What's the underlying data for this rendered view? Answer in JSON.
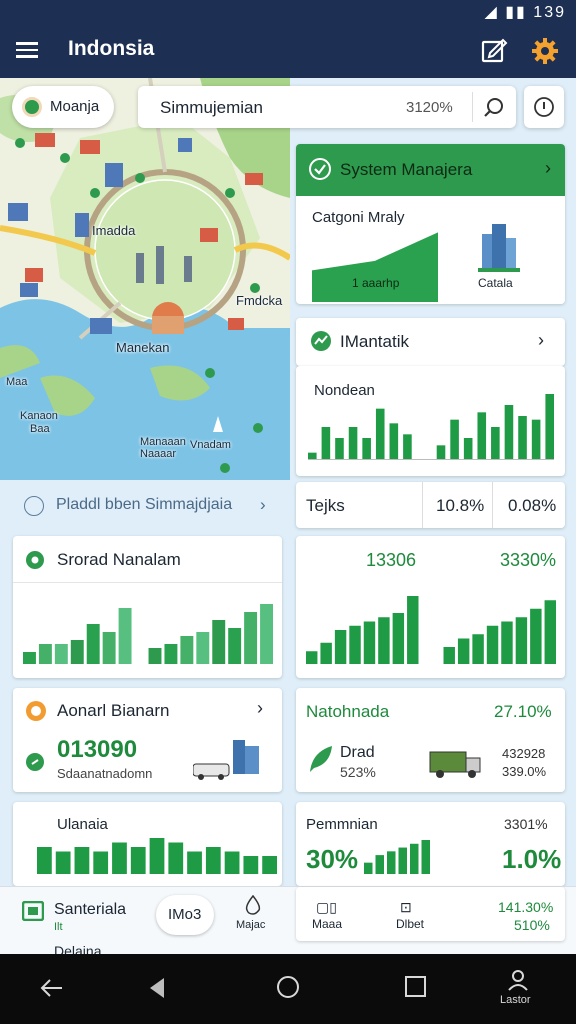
{
  "status": {
    "time": "139"
  },
  "header": {
    "title": "Indonsia"
  },
  "map": {
    "chip_label": "Moanja",
    "labels": [
      "Imadda",
      "Fmdcka",
      "Manekan",
      "Kanaon",
      "Baa",
      "Manaaan",
      "Naaaar",
      "Vnadam",
      "Maa"
    ]
  },
  "search": {
    "value": "Simmujemian",
    "percent": "3120%"
  },
  "system_card": {
    "title": "System Manajera",
    "subtitle": "Catgoni Mraly",
    "bar_label": "1 aaarhp",
    "icon_label": "Catala"
  },
  "mantatik_card": {
    "title": "IMantatik",
    "subtitle": "Nondean"
  },
  "nav_row": {
    "label": "Pladdl bben Simmajdjaia"
  },
  "tabs_row": {
    "label": "Tejks",
    "value1": "10.8%",
    "value2": "0.08%"
  },
  "srorad_card": {
    "title": "Srorad Nanalam"
  },
  "pct_card": {
    "value1": "13306",
    "value2": "3330%"
  },
  "aonarl_card": {
    "title": "Aonarl Bianarn",
    "amount": "013090",
    "sub": "Sdaanatnadomn"
  },
  "natohade_card": {
    "title": "Natohnada",
    "percent": "27.10%",
    "item_title": "Drad",
    "item_sub": "523%",
    "right1": "432928",
    "right2": "339.0%"
  },
  "ulanaia_card": {
    "title": "Ulanaia"
  },
  "permnan_card": {
    "title": "Pemmnian",
    "top_right": "3301%",
    "left_value": "30%",
    "right_value": "1.0%"
  },
  "bottom_row": {
    "left_title": "Santeriala",
    "left_sub": "Ilt",
    "left_below": "Delaina",
    "pill": "IMo3",
    "majac": "Majac",
    "item1": "Maaa",
    "item2": "Dlbet",
    "right1": "141.30%",
    "right2": "510%"
  },
  "navbar": {
    "account_label": "Lastor"
  },
  "colors": {
    "header": "#1d2f52",
    "accent": "#2e9a4e",
    "bars": "#1f9a45"
  },
  "chart_data": [
    {
      "type": "area",
      "title": "Catgoni Mraly",
      "values": [
        10,
        13,
        22
      ]
    },
    {
      "type": "bar",
      "title": "Nondean",
      "values": [
        2,
        9,
        6,
        9,
        6,
        14,
        10,
        7,
        4,
        11,
        6,
        13,
        9,
        15,
        12,
        11,
        18
      ]
    },
    {
      "type": "bar",
      "title": "Srorad Nanalam",
      "series": [
        {
          "name": "",
          "values": [
            3,
            5,
            5,
            6,
            10,
            8,
            14
          ]
        },
        {
          "name": "",
          "values": [
            4,
            5,
            7,
            8,
            11,
            9,
            13,
            15
          ]
        }
      ]
    },
    {
      "type": "bar",
      "series": [
        {
          "name": "",
          "values": [
            3,
            5,
            8,
            9,
            10,
            11,
            12,
            16
          ]
        },
        {
          "name": "",
          "values": [
            4,
            6,
            7,
            9,
            10,
            11,
            13,
            15
          ]
        }
      ]
    },
    {
      "type": "bar",
      "title": "Ulanaia",
      "values": [
        6,
        5,
        6,
        5,
        7,
        6,
        8,
        7,
        5,
        6,
        5,
        4,
        4
      ]
    },
    {
      "type": "bar",
      "title": "Pemmnian",
      "values": [
        3,
        5,
        6,
        7,
        8,
        9
      ]
    }
  ]
}
